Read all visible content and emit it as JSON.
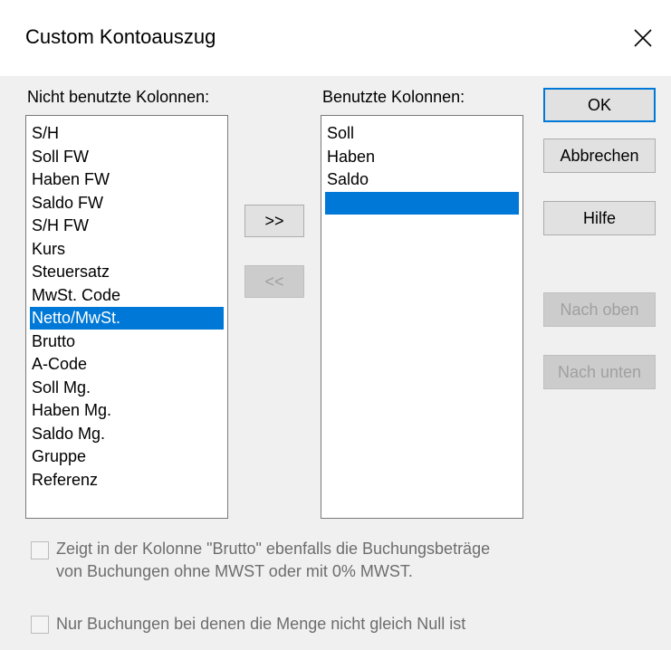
{
  "window": {
    "title": "Custom Kontoauszug"
  },
  "labels": {
    "unused": "Nicht benutzte Kolonnen:",
    "used": "Benutzte Kolonnen:"
  },
  "unused_list": {
    "items": [
      "S/H",
      "Soll FW",
      "Haben FW",
      "Saldo FW",
      "S/H FW",
      "Kurs",
      "Steuersatz",
      "MwSt. Code",
      "Netto/MwSt.",
      "Brutto",
      "A-Code",
      "Soll Mg.",
      "Haben Mg.",
      "Saldo Mg.",
      "Gruppe",
      "Referenz"
    ],
    "selected_index": 8
  },
  "used_list": {
    "items": [
      "Soll",
      "Haben",
      "Saldo",
      ""
    ],
    "selected_index": 3
  },
  "buttons": {
    "add": ">>",
    "remove": "<<",
    "ok": "OK",
    "cancel": "Abbrechen",
    "help": "Hilfe",
    "up": "Nach oben",
    "down": "Nach unten"
  },
  "options": {
    "brutto_line1": "Zeigt in der Kolonne \"Brutto\" ebenfalls die Buchungsbeträge",
    "brutto_line2": "von Buchungen ohne MWST oder mit 0% MWST.",
    "menge": "Nur Buchungen bei denen die Menge nicht gleich Null ist"
  },
  "colors": {
    "selection": "#0078d7",
    "window_bg": "#f0f0f0",
    "disabled_text": "#a0a0a0"
  }
}
